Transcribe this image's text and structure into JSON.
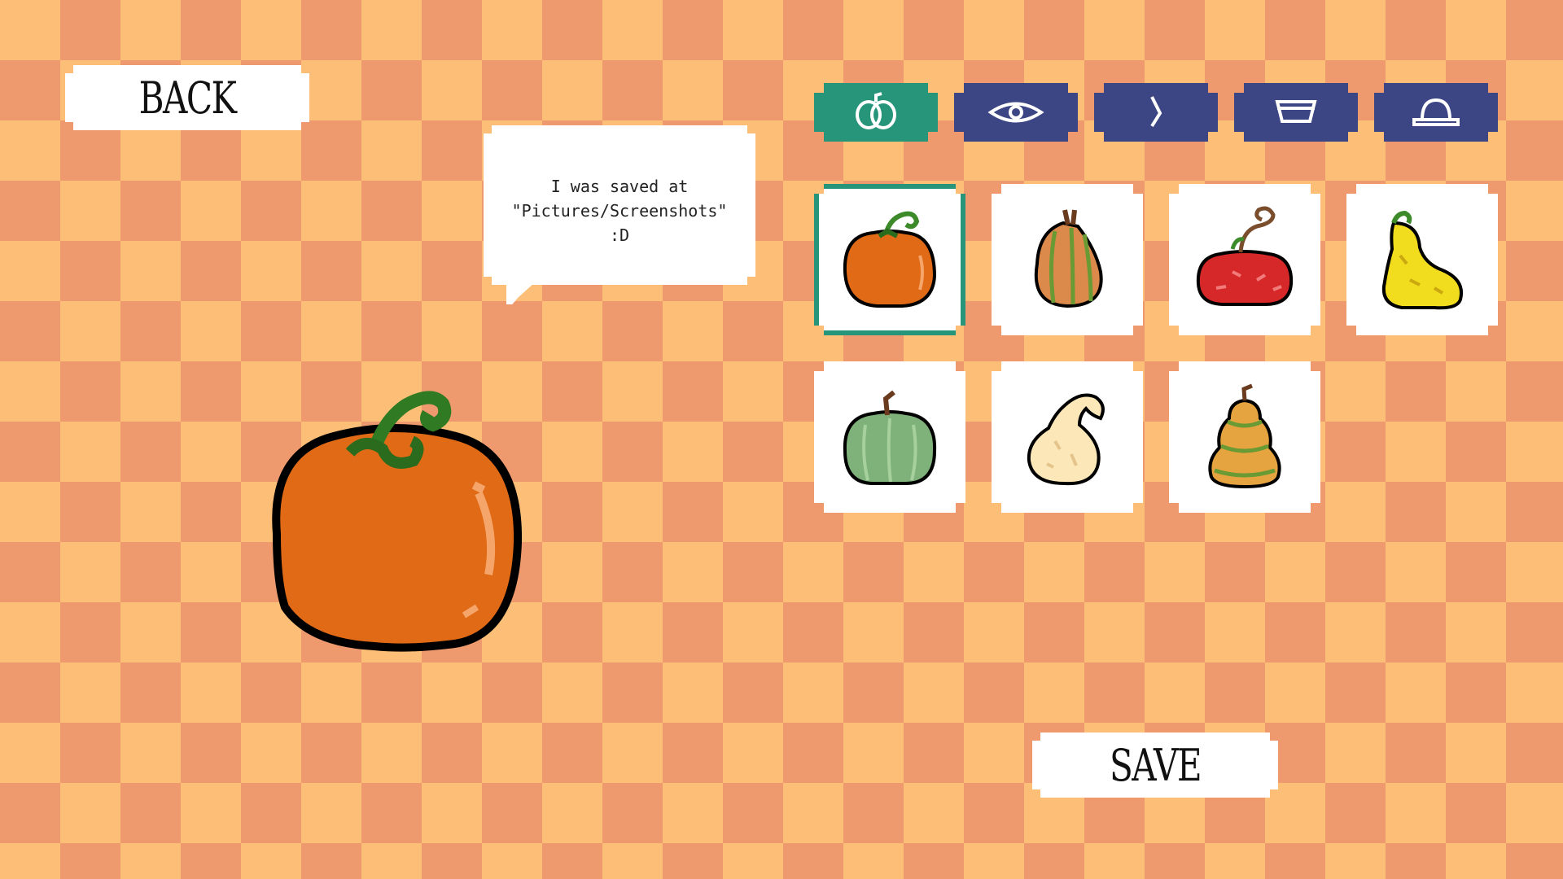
{
  "back_label": "BACK",
  "save_label": "SAVE",
  "speech_bubble": {
    "lines": [
      "I was saved at",
      "\"Pictures/Screenshots\"",
      ":D"
    ]
  },
  "tabs": [
    {
      "icon": "pumpkin-body-icon",
      "active": true
    },
    {
      "icon": "eye-icon",
      "active": false
    },
    {
      "icon": "nose-icon",
      "active": false
    },
    {
      "icon": "mouth-icon",
      "active": false
    },
    {
      "icon": "hat-icon",
      "active": false
    }
  ],
  "pumpkins": [
    {
      "icon": "orange-pumpkin-icon",
      "selected": true
    },
    {
      "icon": "striped-gourd-icon",
      "selected": false
    },
    {
      "icon": "red-pumpkin-icon",
      "selected": false
    },
    {
      "icon": "yellow-gourd-icon",
      "selected": false
    },
    {
      "icon": "green-pumpkin-icon",
      "selected": false
    },
    {
      "icon": "swan-gourd-icon",
      "selected": false
    },
    {
      "icon": "stacked-gourd-icon",
      "selected": false
    }
  ],
  "colors": {
    "accent": "#26957a",
    "tab": "#3c4684",
    "checker_light": "#fdbf78",
    "checker_dark": "#ee9a6e",
    "pumpkin_orange": "#e06a16"
  }
}
